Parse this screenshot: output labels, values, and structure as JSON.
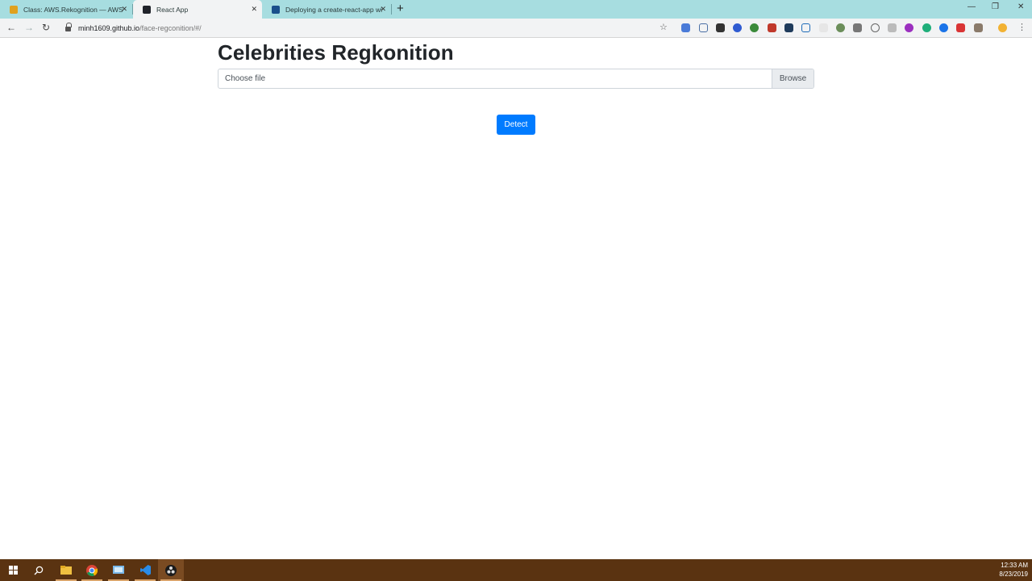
{
  "browser": {
    "tabs": [
      {
        "title": "Class: AWS.Rekognition — AWS",
        "active": false
      },
      {
        "title": "React App",
        "active": true
      },
      {
        "title": "Deploying a create-react-app wi",
        "active": false
      }
    ],
    "url_host": "minh1609.github.io",
    "url_path": "/face-regconition/#/"
  },
  "page": {
    "title": "Celebrities Regkonition",
    "file_input": {
      "placeholder": "Choose file",
      "browse_label": "Browse"
    },
    "detect_label": "Detect"
  },
  "taskbar": {
    "time": "12:33 AM",
    "date": "8/23/2019"
  },
  "colors": {
    "tabstrip": "#a7dde0",
    "primary_button": "#007bff",
    "taskbar": "#5a3311"
  }
}
